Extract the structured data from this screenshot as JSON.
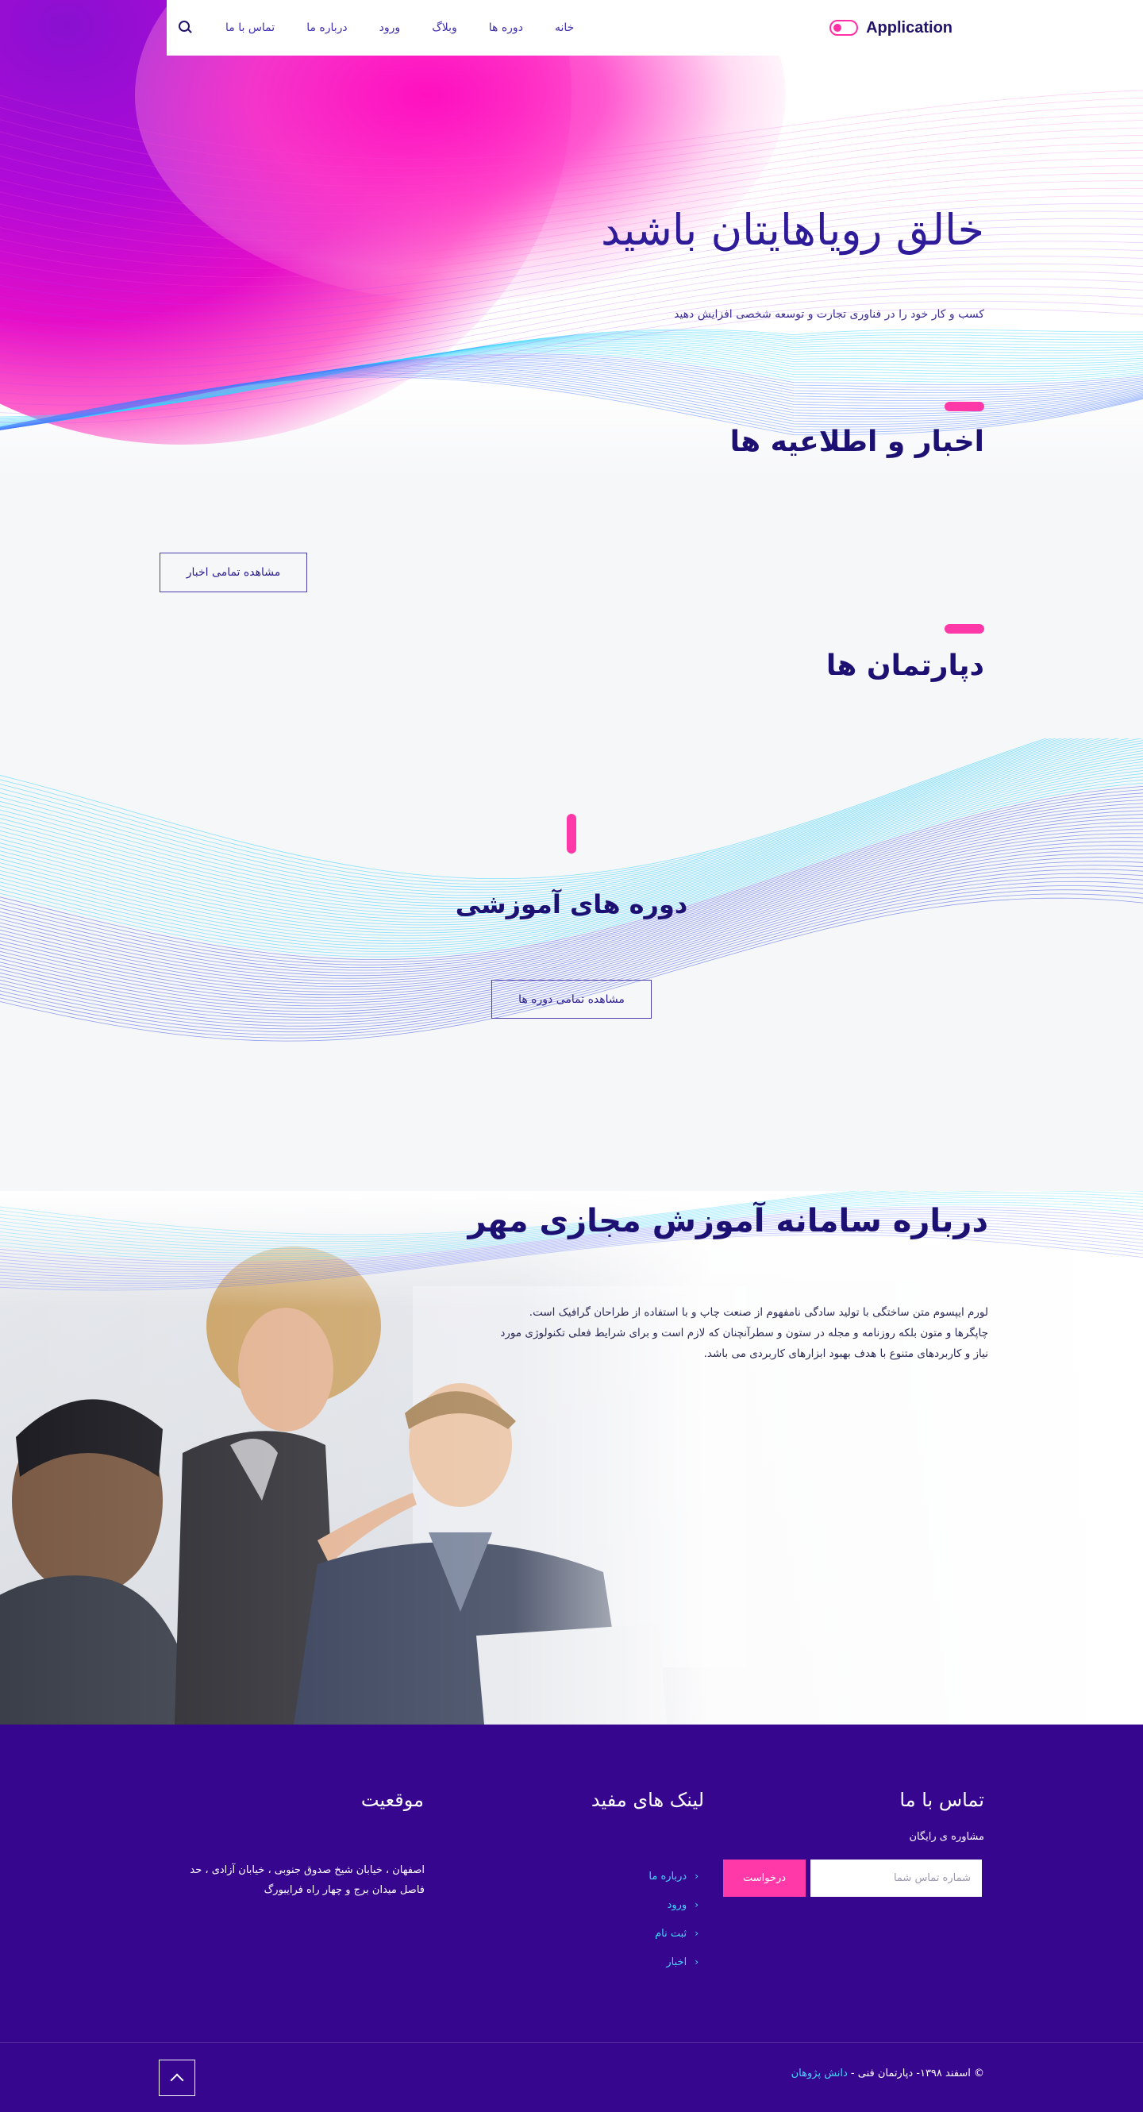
{
  "brand": {
    "name": "Application",
    "accent": "#ff2fa5"
  },
  "nav": {
    "items": [
      "خانه",
      "دوره ها",
      "وبلاگ",
      "ورود",
      "درباره ما",
      "تماس با ما"
    ],
    "search_icon": "search-icon"
  },
  "hero": {
    "title": "خالق رویاهایتان باشید",
    "subtitle": "کسب و کار خود را در فناوری تجارت و توسعه شخصی افزایش دهید"
  },
  "news": {
    "title": "اخبار و اطلاعیه ها",
    "button": "مشاهده تمامی اخبار"
  },
  "departments": {
    "title": "دپارتمان ها"
  },
  "courses": {
    "title": "دوره های آموزشی",
    "button": "مشاهده تمامی دوره ها"
  },
  "about": {
    "title": "درباره سامانه آموزش مجازی مهر",
    "text": "لورم ایپسوم متن ساختگی با تولید سادگی نامفهوم از صنعت چاپ و با استفاده از طراحان گرافیک است. چاپگرها و متون بلکه روزنامه و مجله در ستون و سطرآنچنان که لازم است و برای شرایط فعلی تکنولوژی مورد نیاز و کاربردهای متنوع با هدف بهبود ابزارهای کاربردی می باشد."
  },
  "footer": {
    "contact": {
      "title": "تماس با ما",
      "note": "مشاوره ی رایگان",
      "placeholder": "شماره تماس شما",
      "button": "درخواست"
    },
    "links": {
      "title": "لینک های مفید",
      "items": [
        "درباره ما",
        "ورود",
        "ثبت نام",
        "اخبار"
      ]
    },
    "location": {
      "title": "موقعیت",
      "address": "اصفهان ، خیابان شیخ صدوق جنوبی ، خیابان آزادی ، حد فاصل میدان برج و چهار راه فرایبورگ"
    },
    "copyright_prefix": "© اسفند ۱۳۹۸- دپارتمان فنی - ",
    "copyright_link": "دانش پژوهان",
    "to_top_icon": "chevron-up-icon"
  },
  "colors": {
    "primary": "#2d1b9a",
    "accent": "#ff3aa8",
    "footer_bg": "#36068e",
    "link": "#41d6ff"
  }
}
